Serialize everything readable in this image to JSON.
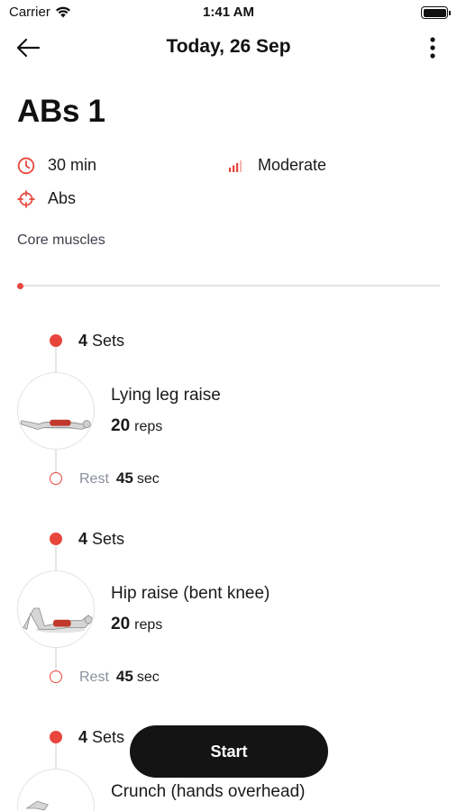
{
  "status_bar": {
    "carrier": "Carrier",
    "time": "1:41 AM"
  },
  "nav": {
    "title": "Today, 26 Sep"
  },
  "workout": {
    "title": "ABs 1",
    "duration": "30 min",
    "difficulty": "Moderate",
    "target": "Abs",
    "muscles_label": "Core muscles"
  },
  "exercises": [
    {
      "sets_num": "4",
      "sets_word": "Sets",
      "name": "Lying leg raise",
      "reps_num": "20",
      "reps_word": "reps",
      "rest_label": "Rest",
      "rest_num": "45",
      "rest_unit": "sec"
    },
    {
      "sets_num": "4",
      "sets_word": "Sets",
      "name": "Hip raise (bent knee)",
      "reps_num": "20",
      "reps_word": "reps",
      "rest_label": "Rest",
      "rest_num": "45",
      "rest_unit": "sec"
    },
    {
      "sets_num": "4",
      "sets_word": "Sets",
      "name": "Crunch (hands overhead)"
    }
  ],
  "start_button": {
    "label": "Start"
  },
  "colors": {
    "accent": "#e8463c",
    "button_bg": "#141414",
    "muted_text": "#8a909c"
  },
  "icons": {
    "back": "arrow-left-icon",
    "more": "more-vertical-icon",
    "duration": "clock-icon",
    "difficulty": "signal-bars-icon",
    "target": "crosshair-icon"
  }
}
